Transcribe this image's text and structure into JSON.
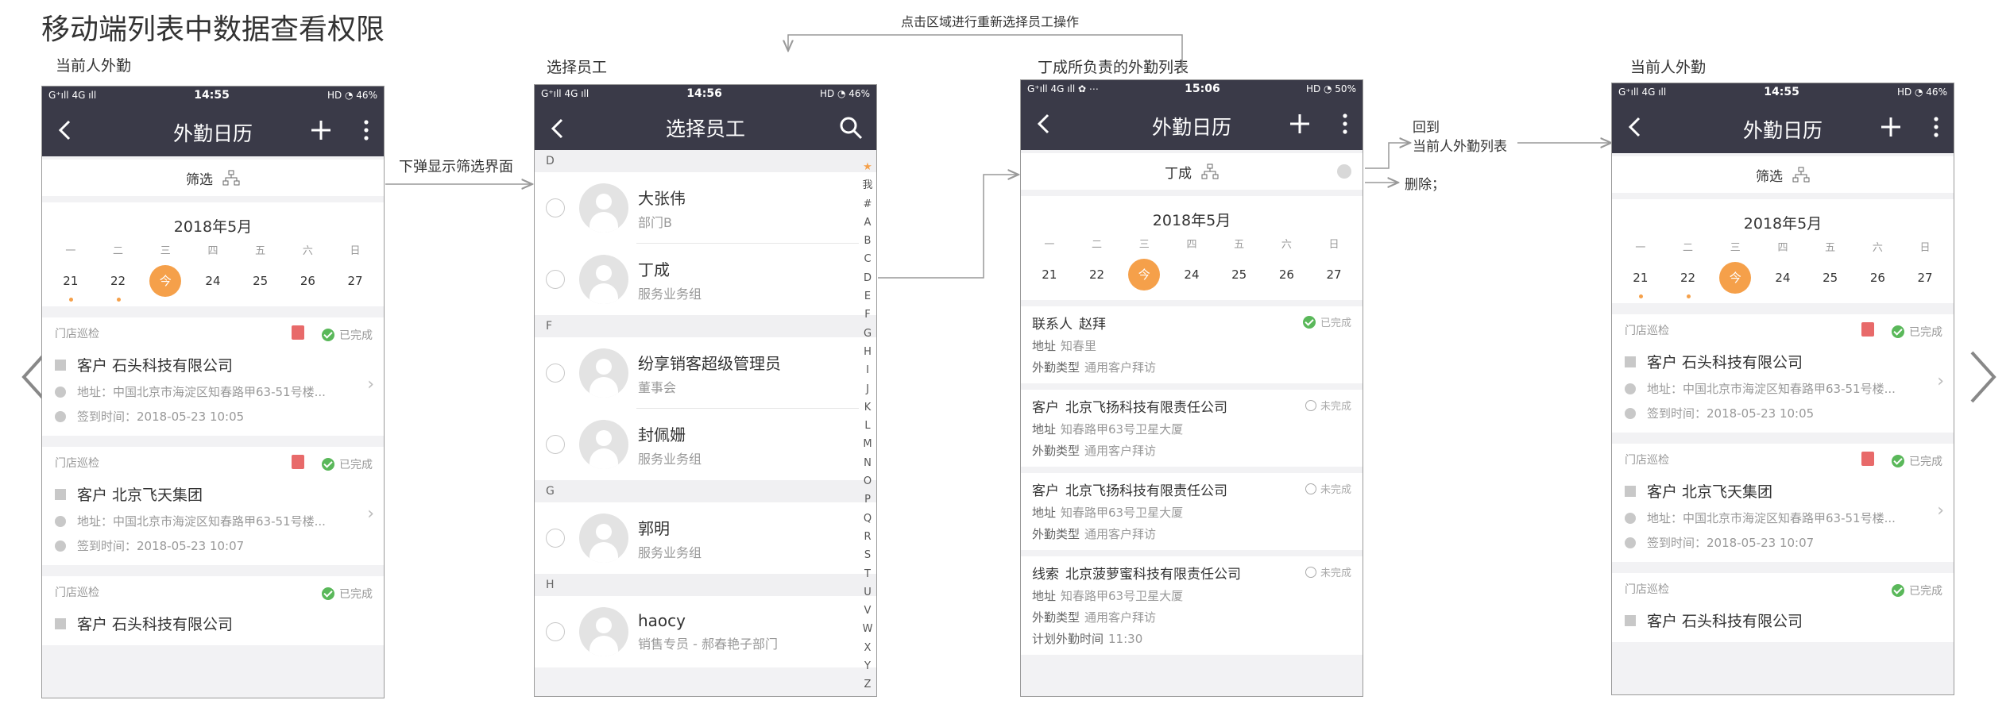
{
  "page_title": "移动端列表中数据查看权限",
  "captions": {
    "p1": "当前人外勤",
    "p2": "选择员工",
    "p3": "丁成所负责的外勤列表",
    "p4": "当前人外勤"
  },
  "flow_labels": {
    "popup": "下弹显示筛选界面",
    "reselect": "点击区域进行重新选择员工操作",
    "back_line1": "回到",
    "back_line2": "当前人外勤列表",
    "delete": "删除；"
  },
  "colors": {
    "header": "#3a3a48",
    "today": "#f5a04a",
    "done": "#5ab85a"
  },
  "phone1": {
    "status": {
      "left": "G⁺ıll 4G ıll",
      "time": "14:55",
      "right": "HD ◔ 46%"
    },
    "nav_title": "外勤日历",
    "filter_label": "筛选",
    "calendar": {
      "month": "2018年5月",
      "weekdays": [
        "一",
        "二",
        "三",
        "四",
        "五",
        "六",
        "日"
      ],
      "days": [
        "21",
        "22",
        "今",
        "24",
        "25",
        "26",
        "27"
      ]
    },
    "cards": [
      {
        "type": "门店巡检",
        "status": "已完成",
        "customer": "客户  石头科技有限公司",
        "address": "地址：中国北京市海淀区知春路甲63-51号楼...",
        "signin": "签到时间：2018-05-23 10:05"
      },
      {
        "type": "门店巡检",
        "status": "已完成",
        "customer": "客户  北京飞天集团",
        "address": "地址：中国北京市海淀区知春路甲63-51号楼...",
        "signin": "签到时间：2018-05-23 10:07"
      },
      {
        "type": "门店巡检",
        "status": "已完成",
        "customer": "客户  石头科技有限公司"
      }
    ]
  },
  "phone2": {
    "status": {
      "left": "G⁺ıll 4G ıll",
      "time": "14:56",
      "right": "HD ◔ 46%"
    },
    "nav_title": "选择员工",
    "sections": [
      {
        "letter": "D",
        "employees": [
          {
            "name": "大张伟",
            "dept": "部门B"
          },
          {
            "name": "丁成",
            "dept": "服务业务组"
          }
        ]
      },
      {
        "letter": "F",
        "employees": [
          {
            "name": "纷享销客超级管理员",
            "dept": "董事会"
          },
          {
            "name": "封佩姗",
            "dept": "服务业务组"
          }
        ]
      },
      {
        "letter": "G",
        "employees": [
          {
            "name": "郭明",
            "dept": "服务业务组"
          }
        ]
      },
      {
        "letter": "H",
        "employees": [
          {
            "name": "haocy",
            "dept": "销售专员 - 郝春艳子部门"
          }
        ]
      }
    ],
    "index": [
      "★",
      "我",
      "#",
      "A",
      "B",
      "C",
      "D",
      "E",
      "F",
      "G",
      "H",
      "I",
      "J",
      "K",
      "L",
      "M",
      "N",
      "O",
      "P",
      "Q",
      "R",
      "S",
      "T",
      "U",
      "V",
      "W",
      "X",
      "Y",
      "Z"
    ]
  },
  "phone3": {
    "status": {
      "left": "G⁺ıll 4G ıll ✿ ⋯",
      "time": "15:06",
      "right": "HD ◔ 50%"
    },
    "nav_title": "外勤日历",
    "filter_label": "丁成",
    "calendar": {
      "month": "2018年5月",
      "weekdays": [
        "一",
        "二",
        "三",
        "四",
        "五",
        "六",
        "日"
      ],
      "days": [
        "21",
        "22",
        "今",
        "24",
        "25",
        "26",
        "27"
      ]
    },
    "records": [
      {
        "head_label": "联系人",
        "head_value": "赵拜",
        "status": "已完成",
        "done": true,
        "lines": [
          {
            "label": "地址",
            "value": "知春里"
          },
          {
            "label": "外勤类型",
            "value": "通用客户拜访"
          }
        ]
      },
      {
        "head_label": "客户",
        "head_value": "北京飞扬科技有限责任公司",
        "status": "未完成",
        "done": false,
        "lines": [
          {
            "label": "地址",
            "value": "知春路甲63号卫星大厦"
          },
          {
            "label": "外勤类型",
            "value": "通用客户拜访"
          }
        ]
      },
      {
        "head_label": "客户",
        "head_value": "北京飞扬科技有限责任公司",
        "status": "未完成",
        "done": false,
        "lines": [
          {
            "label": "地址",
            "value": "知春路甲63号卫星大厦"
          },
          {
            "label": "外勤类型",
            "value": "通用客户拜访"
          }
        ]
      },
      {
        "head_label": "线索",
        "head_value": "北京菠萝蜜科技有限责任公司",
        "status": "未完成",
        "done": false,
        "lines": [
          {
            "label": "地址",
            "value": "知春路甲63号卫星大厦"
          },
          {
            "label": "外勤类型",
            "value": "通用客户拜访"
          },
          {
            "label": "计划外勤时间",
            "value": "11:30"
          }
        ]
      }
    ]
  },
  "phone4": {
    "status": {
      "left": "G⁺ıll 4G ıll",
      "time": "14:55",
      "right": "HD ◔ 46%"
    },
    "nav_title": "外勤日历",
    "filter_label": "筛选",
    "calendar": {
      "month": "2018年5月",
      "weekdays": [
        "一",
        "二",
        "三",
        "四",
        "五",
        "六",
        "日"
      ],
      "days": [
        "21",
        "22",
        "今",
        "24",
        "25",
        "26",
        "27"
      ]
    },
    "cards": [
      {
        "type": "门店巡检",
        "status": "已完成",
        "customer": "客户  石头科技有限公司",
        "address": "地址：中国北京市海淀区知春路甲63-51号楼...",
        "signin": "签到时间：2018-05-23 10:05"
      },
      {
        "type": "门店巡检",
        "status": "已完成",
        "customer": "客户  北京飞天集团",
        "address": "地址：中国北京市海淀区知春路甲63-51号楼...",
        "signin": "签到时间：2018-05-23 10:07"
      },
      {
        "type": "门店巡检",
        "status": "已完成",
        "customer": "客户  石头科技有限公司"
      }
    ]
  }
}
